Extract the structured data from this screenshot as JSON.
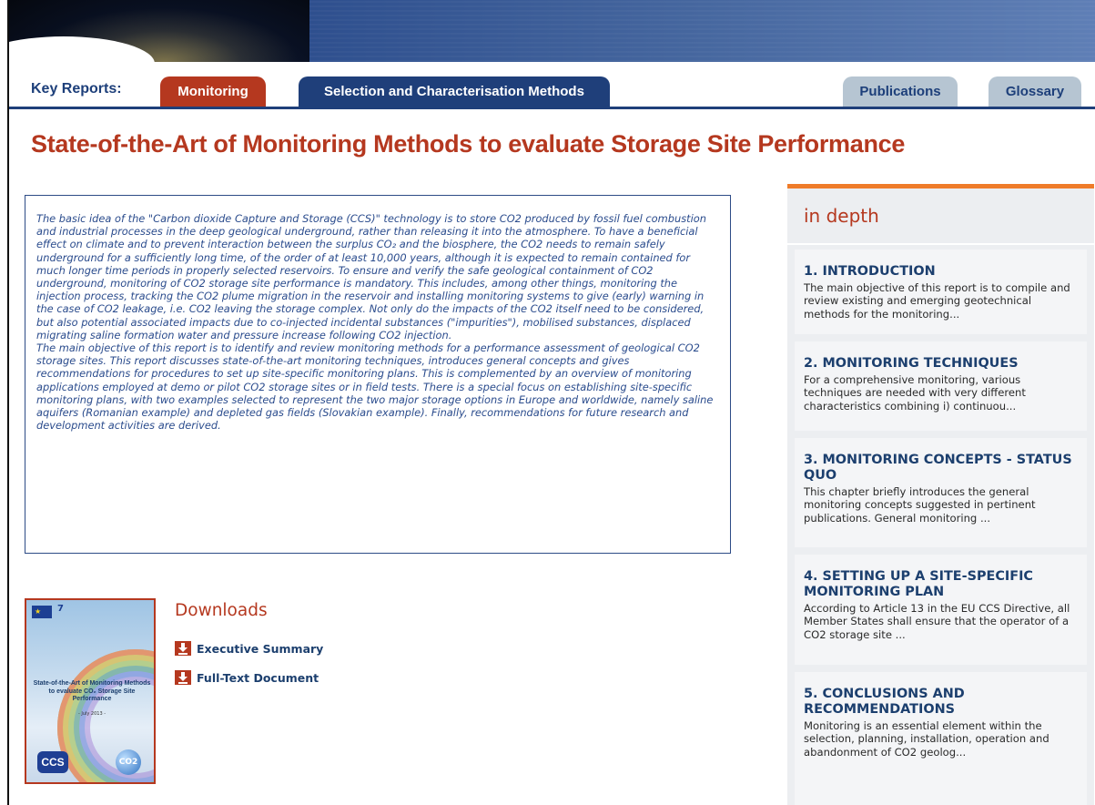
{
  "header": {
    "key_reports_label": "Key Reports:",
    "tabs": [
      {
        "label": "Monitoring"
      },
      {
        "label": "Selection and Characterisation Methods"
      },
      {
        "label": "Publications"
      },
      {
        "label": "Glossary"
      }
    ]
  },
  "page_title": "State-of-the-Art of Monitoring Methods to evaluate Storage Site Performance",
  "abstract": {
    "paragraph_1": "The basic idea of the \"Carbon dioxide Capture and Storage (CCS)\" technology is to store CO2 produced by fossil fuel combustion and industrial processes in the deep geological underground, rather than releasing it into the atmosphere. To have a beneficial effect on climate and to prevent interaction between the surplus CO₂ and the biosphere, the CO2 needs to remain safely underground for a sufficiently long time, of the order of at least 10,000 years, although it is expected to remain contained for much longer time periods in properly selected reservoirs. To ensure and verify the safe geological containment of CO2 underground, monitoring of CO2 storage site performance is mandatory. This includes, among other things, monitoring the injection process, tracking the CO2 plume migration in the reservoir and installing monitoring systems to give (early) warning in the case of CO2 leakage, i.e. CO2 leaving the storage complex. Not only do the impacts of the CO2 itself need to be considered, but also potential associated impacts due to co-injected incidental substances (\"impurities\"), mobilised substances, displaced migrating saline formation water and pressure increase following CO2 injection.",
    "paragraph_2": "The main objective of this report is to identify and review monitoring methods for a performance assessment of geological CO2 storage sites. This report discusses state-of-the-art monitoring techniques, introduces general concepts and gives recommendations for procedures to set up site-specific monitoring plans. This is complemented by an overview of monitoring applications employed at demo or pilot CO2 storage sites or in field tests. There is a special focus on establishing site-specific monitoring plans, with two examples selected to represent the two major storage options in Europe and worldwide, namely saline aquifers (Romanian example) and depleted gas fields (Slovakian example). Finally, recommendations for future research and development activities are derived."
  },
  "cover": {
    "title": "State-of-the-Art of Monitoring Methods to evaluate CO₂ Storage Site Performance",
    "date": "- July 2013 -",
    "logo_left": "CCS",
    "logo_right": "CO2",
    "fp7": "7"
  },
  "downloads": {
    "title": "Downloads",
    "items": [
      {
        "label": "Executive Summary"
      },
      {
        "label": "Full-Text Document"
      }
    ]
  },
  "sidebar": {
    "title": "in depth",
    "sections": [
      {
        "title": "1. INTRODUCTION",
        "text": "The main objective of this report is to compile and review existing and emerging geotechnical methods for the monitoring..."
      },
      {
        "title": "2. MONITORING TECHNIQUES",
        "text": "For a comprehensive monitoring, various techniques are needed with very different characteristics combining i) continuou..."
      },
      {
        "title": "3. MONITORING CONCEPTS - STATUS QUO",
        "text": "This chapter briefly introduces the general monitoring concepts suggested in pertinent publications. General monitoring ..."
      },
      {
        "title": "4. SETTING UP A SITE-SPECIFIC MONITORING PLAN",
        "text": "According to Article 13 in the EU CCS Directive, all Member States shall ensure that the operator of a CO2 storage site ..."
      },
      {
        "title": "5. CONCLUSIONS AND RECOMMENDATIONS",
        "text": "Monitoring is an essential element within the selection, planning, installation, operation and abandonment of CO2 geolog..."
      }
    ]
  },
  "colors": {
    "brand_red": "#b5381f",
    "brand_blue": "#1f3f7a",
    "tab_inactive": "#b6c5d2",
    "sidebar_bg": "#eceef1",
    "accent_orange": "#ef7c2a"
  },
  "icons": [
    "download-icon"
  ]
}
